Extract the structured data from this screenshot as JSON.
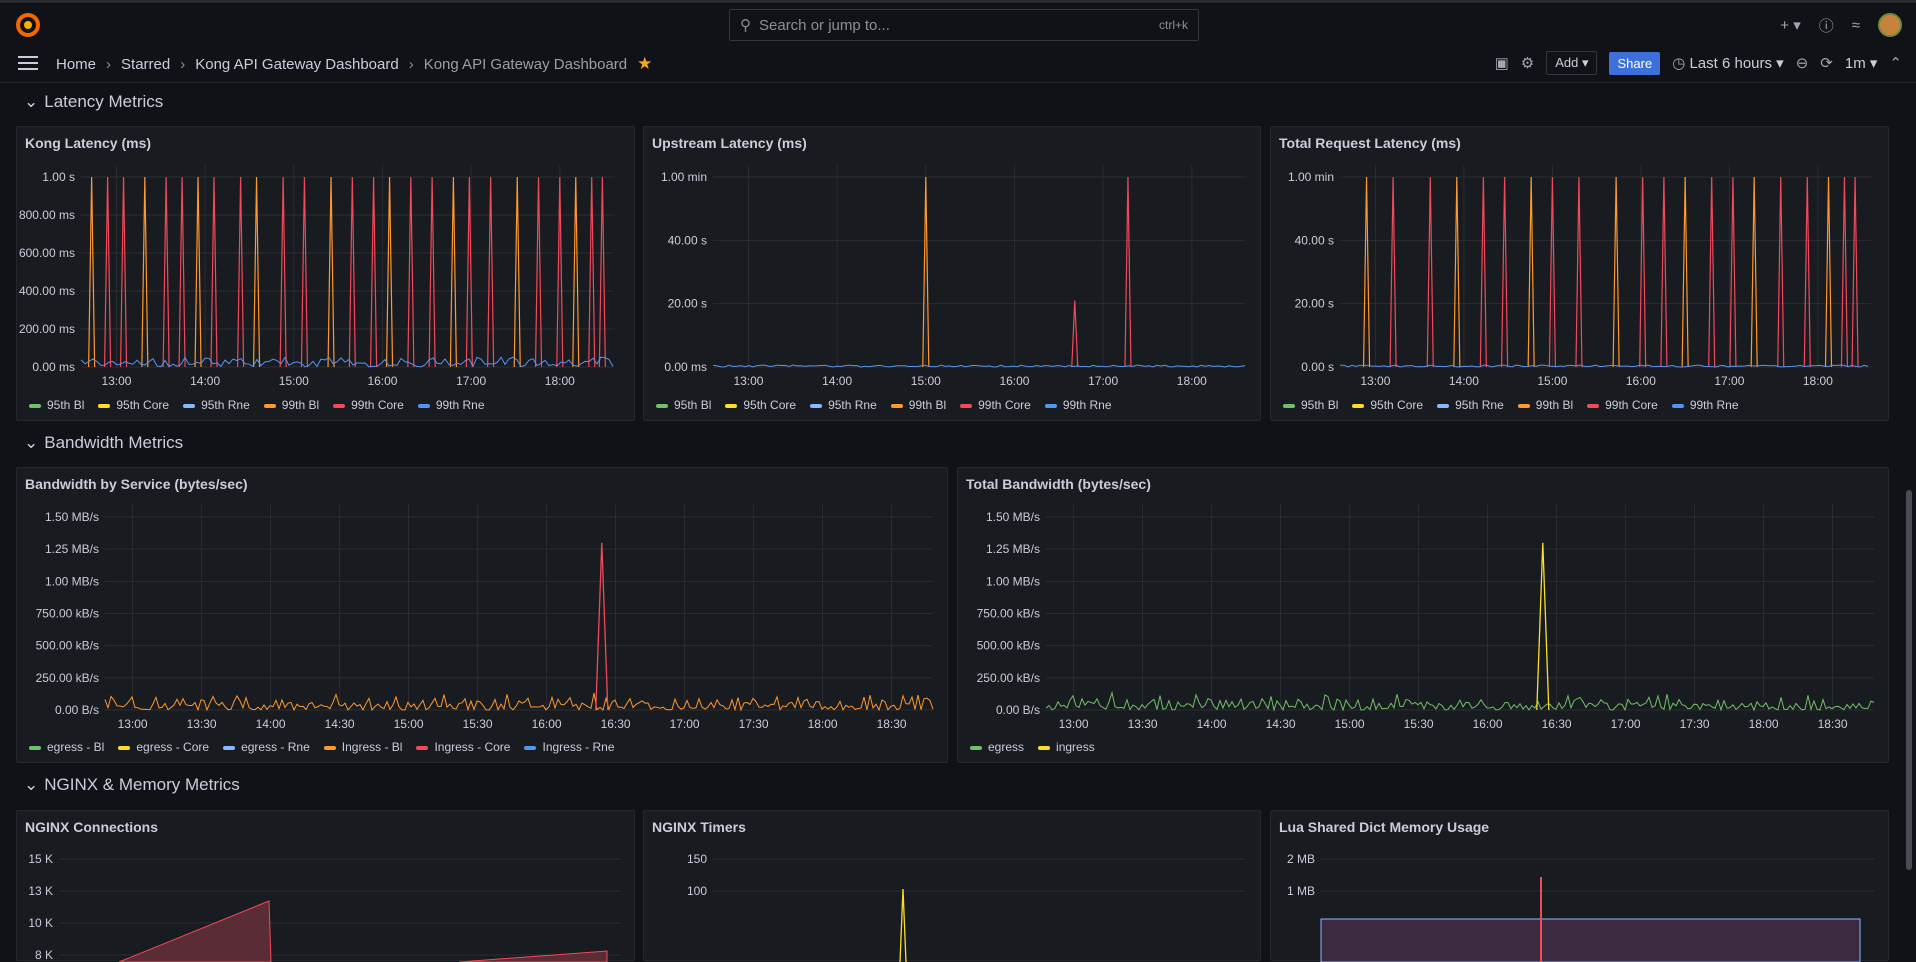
{
  "app": {
    "title": "Grafana"
  },
  "search": {
    "placeholder": "Search or jump to...",
    "shortcut": "ctrl+k"
  },
  "breadcrumbs": [
    "Home",
    "Starred",
    "Kong API Gateway Dashboard",
    "Kong API Gateway Dashboard"
  ],
  "toolbar": {
    "add_label": "Add",
    "share_label": "Share",
    "time_range": "Last 6 hours",
    "refresh": "1m"
  },
  "sections": [
    {
      "title": "Latency Metrics"
    },
    {
      "title": "Bandwidth Metrics"
    },
    {
      "title": "NGINX & Memory Metrics"
    }
  ],
  "colors": {
    "bg": "#111217",
    "panel": "#181b1f",
    "green": "#73bf69",
    "yellow": "#fade2a",
    "blue": "#8ab8ff",
    "orange": "#ff9830",
    "red": "#f2495c",
    "blue2": "#5794f2",
    "accent": "#3d71d9"
  },
  "chart_data": [
    {
      "type": "line",
      "title": "Kong Latency (ms)",
      "y_ticks": [
        "1.00 s",
        "800.00 ms",
        "600.00 ms",
        "400.00 ms",
        "200.00 ms",
        "0.00 ms"
      ],
      "x_ticks": [
        "13:00",
        "14:00",
        "15:00",
        "16:00",
        "17:00",
        "18:00"
      ],
      "legend": [
        "95th Bl",
        "95th Core",
        "95th Rne",
        "99th Bl",
        "99th Core",
        "99th Rne"
      ],
      "series": [
        {
          "name": "99th Core",
          "spikes": [
            0.02,
            0.05,
            0.08,
            0.12,
            0.16,
            0.19,
            0.22,
            0.25,
            0.3,
            0.33,
            0.38,
            0.42,
            0.47,
            0.51,
            0.55,
            0.58,
            0.62,
            0.66,
            0.7,
            0.73,
            0.77,
            0.82,
            0.86,
            0.9,
            0.93,
            0.96,
            0.98
          ],
          "peak": 1.0
        }
      ]
    },
    {
      "type": "line",
      "title": "Upstream Latency (ms)",
      "y_ticks": [
        "1.00 min",
        "40.00 s",
        "20.00 s",
        "0.00 ms"
      ],
      "x_ticks": [
        "13:00",
        "14:00",
        "15:00",
        "16:00",
        "17:00",
        "18:00"
      ],
      "legend": [
        "95th Bl",
        "95th Core",
        "95th Rne",
        "99th Bl",
        "99th Core",
        "99th Rne"
      ],
      "series": [
        {
          "name": "99th Core",
          "spikes": [
            0.4,
            0.68,
            0.78
          ],
          "peaks": [
            1.0,
            0.35,
            1.0
          ]
        }
      ]
    },
    {
      "type": "line",
      "title": "Total Request Latency (ms)",
      "y_ticks": [
        "1.00 min",
        "40.00 s",
        "20.00 s",
        "0.00 s"
      ],
      "x_ticks": [
        "13:00",
        "14:00",
        "15:00",
        "16:00",
        "17:00",
        "18:00"
      ],
      "legend": [
        "95th Bl",
        "95th Core",
        "95th Rne",
        "99th Bl",
        "99th Core",
        "99th Rne"
      ],
      "series": [
        {
          "name": "99th Core",
          "spikes": [
            0.05,
            0.1,
            0.17,
            0.22,
            0.27,
            0.31,
            0.36,
            0.4,
            0.45,
            0.52,
            0.57,
            0.61,
            0.65,
            0.7,
            0.74,
            0.78,
            0.83,
            0.88,
            0.92,
            0.95,
            0.97
          ],
          "peak": 1.0
        }
      ]
    },
    {
      "type": "area",
      "title": "Bandwidth by Service (bytes/sec)",
      "y_ticks": [
        "1.50 MB/s",
        "1.25 MB/s",
        "1.00 MB/s",
        "750.00 kB/s",
        "500.00 kB/s",
        "250.00 kB/s",
        "0.00 B/s"
      ],
      "x_ticks": [
        "13:00",
        "13:30",
        "14:00",
        "14:30",
        "15:00",
        "15:30",
        "16:00",
        "16:30",
        "17:00",
        "17:30",
        "18:00",
        "18:30"
      ],
      "legend": [
        "egress - Bl",
        "egress - Core",
        "egress - Rne",
        "Ingress - Bl",
        "Ingress - Core",
        "Ingress - Rne"
      ],
      "series": [
        {
          "name": "Ingress - Core",
          "spike_x": 0.6,
          "peak": 1.3
        }
      ]
    },
    {
      "type": "area",
      "title": "Total Bandwidth (bytes/sec)",
      "y_ticks": [
        "1.50 MB/s",
        "1.25 MB/s",
        "1.00 MB/s",
        "750.00 kB/s",
        "500.00 kB/s",
        "250.00 kB/s",
        "0.00 B/s"
      ],
      "x_ticks": [
        "13:00",
        "13:30",
        "14:00",
        "14:30",
        "15:00",
        "15:30",
        "16:00",
        "16:30",
        "17:00",
        "17:30",
        "18:00",
        "18:30"
      ],
      "legend": [
        "egress",
        "ingress"
      ],
      "series": [
        {
          "name": "ingress",
          "spike_x": 0.6,
          "peak": 1.3
        }
      ]
    },
    {
      "type": "area",
      "title": "NGINX Connections",
      "y_ticks": [
        "15 K",
        "13 K",
        "10 K",
        "8 K"
      ]
    },
    {
      "type": "line",
      "title": "NGINX Timers",
      "y_ticks": [
        "150",
        "100"
      ]
    },
    {
      "type": "area",
      "title": "Lua Shared Dict Memory Usage",
      "y_ticks": [
        "2 MB",
        "1 MB"
      ]
    }
  ]
}
